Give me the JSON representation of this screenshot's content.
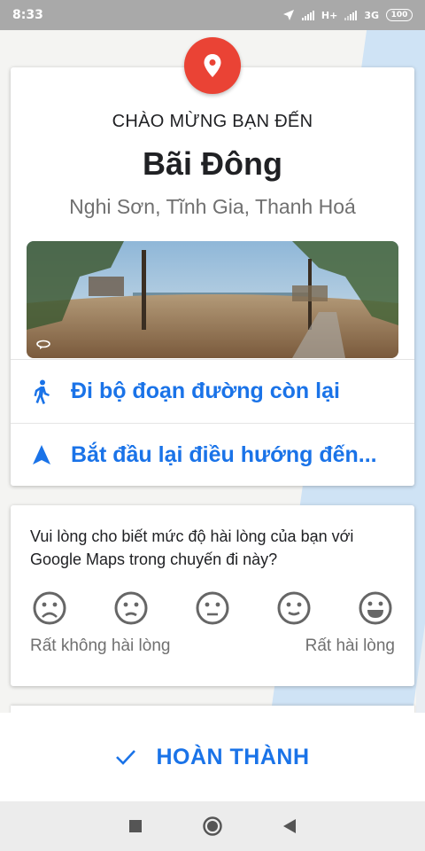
{
  "status_bar": {
    "time": "8:33",
    "network_1": "H+",
    "network_2": "3G",
    "battery": "100"
  },
  "arrival_card": {
    "heading": "CHÀO MỪNG BẠN ĐẾN",
    "place_name": "Bãi Đông",
    "address": "Nghi Sơn, Tĩnh Gia, Thanh Hoá",
    "photo_icon": "panorama-360-icon",
    "actions": [
      {
        "label": "Đi bộ đoạn đường còn lại",
        "icon": "walking-icon"
      },
      {
        "label": "Bắt đầu lại điều hướng đến...",
        "icon": "navigation-arrow-icon"
      }
    ]
  },
  "rating": {
    "question": "Vui lòng cho biết mức độ hài lòng của bạn với Google Maps trong chuyến đi này?",
    "faces": [
      "very-dissatisfied-icon",
      "dissatisfied-icon",
      "neutral-icon",
      "satisfied-icon",
      "very-satisfied-icon"
    ],
    "label_low": "Rất không hài lòng",
    "label_high": "Rất hài lòng"
  },
  "done_button": {
    "label": "HOÀN THÀNH",
    "icon": "check-icon"
  },
  "colors": {
    "accent": "#1a73e8",
    "pin": "#ea4335"
  },
  "nav_bar": {
    "icons": [
      "recents-square-icon",
      "home-circle-icon",
      "back-triangle-icon"
    ]
  }
}
